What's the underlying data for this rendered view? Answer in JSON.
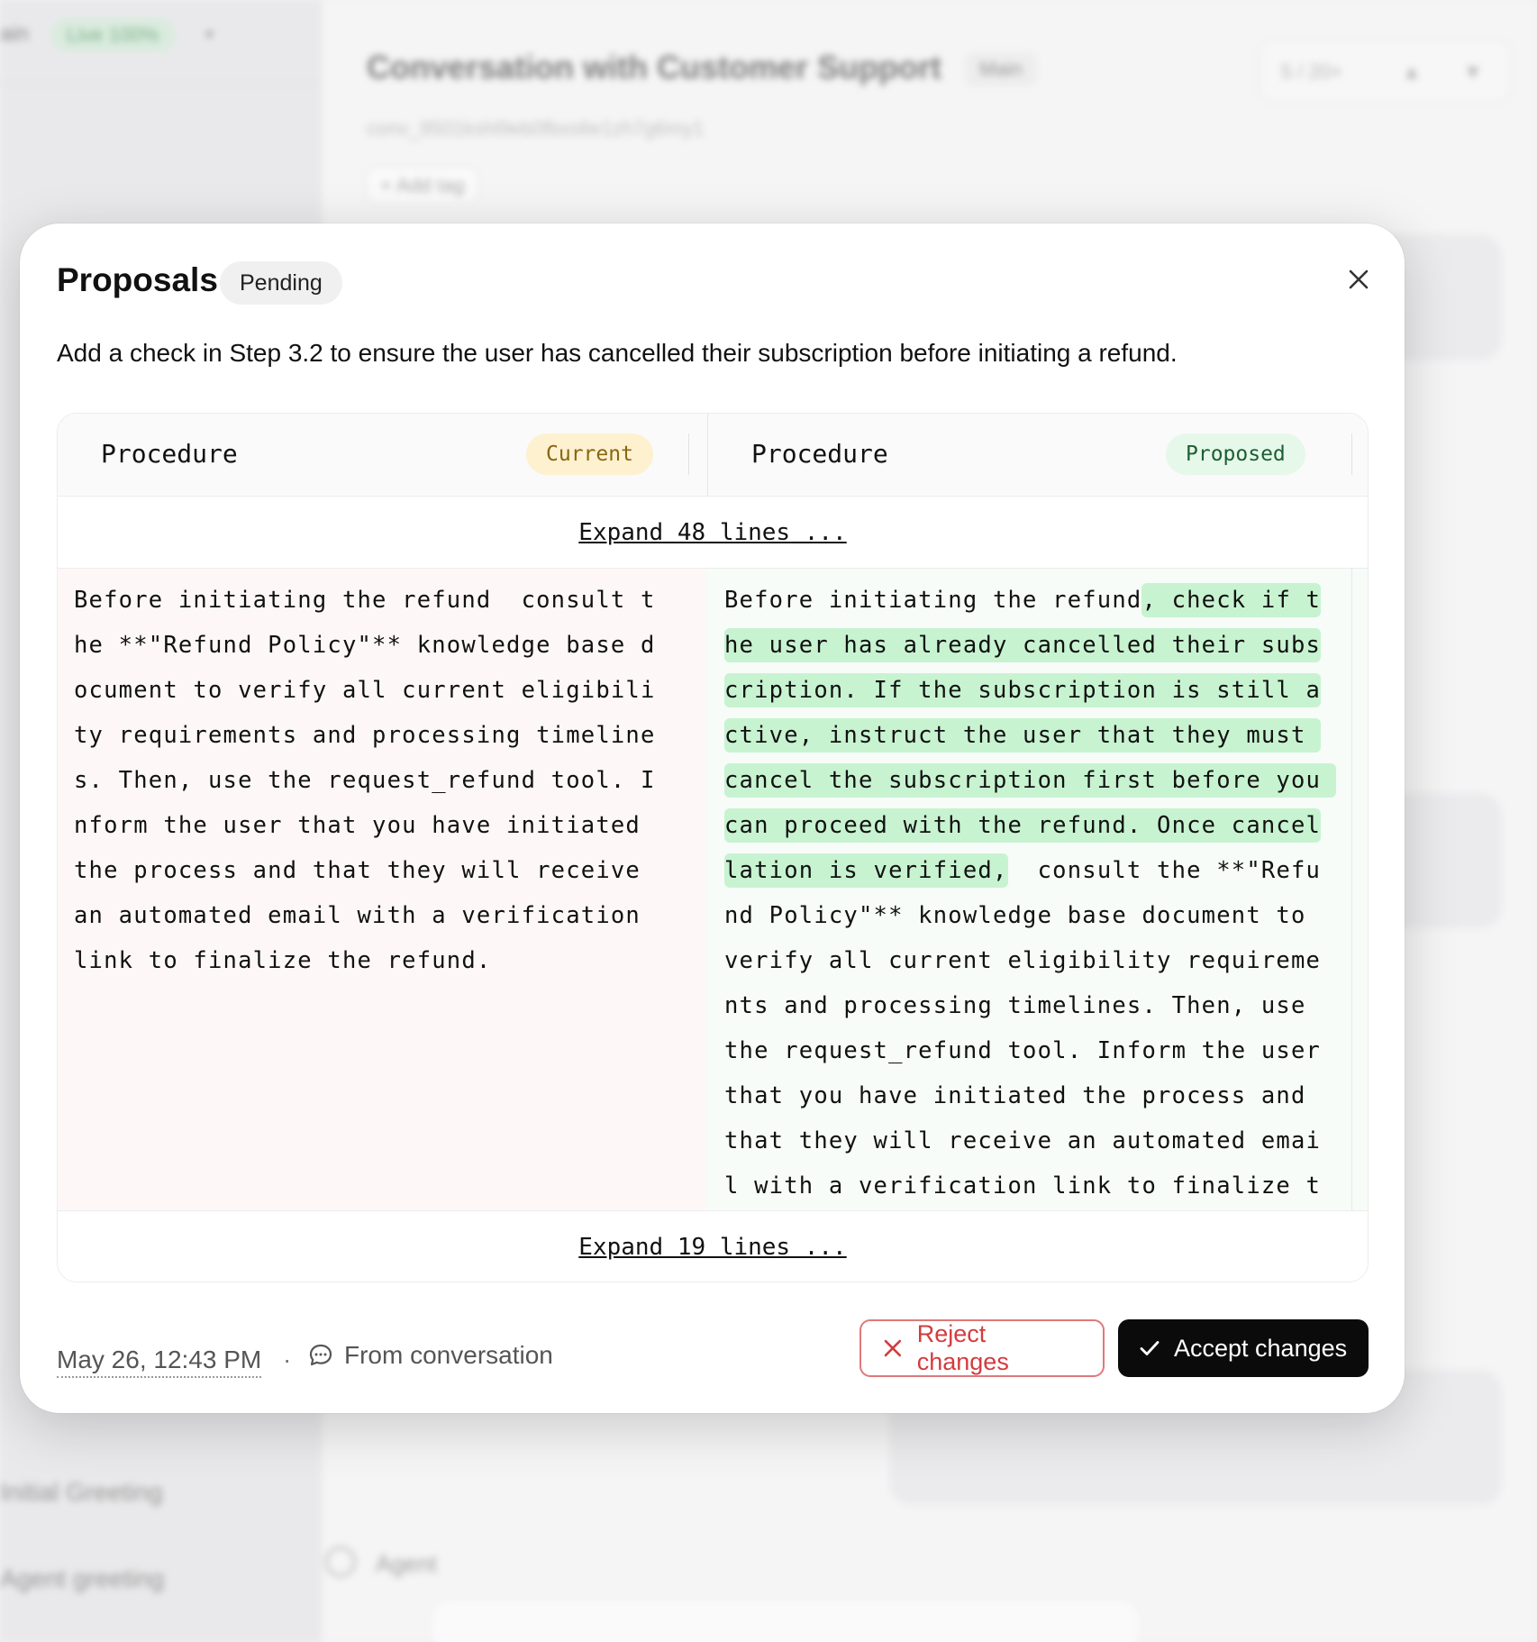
{
  "background": {
    "sidebar": {
      "env_label": "ain",
      "live_badge": "Live 100%",
      "items": [
        "Initial Greeting",
        "Agent greeting"
      ]
    },
    "main": {
      "title": "Conversation with Customer Support",
      "branch": "Main",
      "pager": "5 / 20+",
      "conversation_id": "conv_9501kshl9eb0fbxs6e1zh7g6my1",
      "add_tag": "+ Add tag",
      "agent_label": "Agent"
    }
  },
  "modal": {
    "title": "Proposals",
    "status": "Pending",
    "summary": "Add a check in Step 3.2 to ensure the user has cancelled their subscription before initiating a refund.",
    "diff": {
      "left": {
        "label": "Procedure",
        "tag": "Current"
      },
      "right": {
        "label": "Procedure",
        "tag": "Proposed"
      },
      "expand_top": "Expand 48 lines ...",
      "expand_bottom": "Expand 19 lines ...",
      "current_text": "Before initiating the refund  consult the **\"Refund Policy\"** knowledge base document to verify all current eligibility requirements and processing timelines. Then, use the request_refund tool. Inform the user that you have initiated the process and that they will receive an automated email with a verification link to finalize the refund.",
      "proposed_prefix": "Before initiating the refund",
      "proposed_inserted": ", check if the user has already cancelled their subscription. If the subscription is still active, instruct the user that they must cancel the subscription first before you can proceed with the refund. Once cancellation is verified,",
      "proposed_suffix": "  consult the **\"Refund Policy\"** knowledge base document to verify all current eligibility requirements and processing timelines. Then, use the request_refund tool. Inform the user that you have initiated the process and that they will receive an automated email with a verification link to finalize the refund."
    },
    "footer": {
      "date": "May 26, 12:43 PM",
      "separator": "·",
      "source": "From conversation"
    },
    "actions": {
      "reject": "Reject changes",
      "accept": "Accept changes"
    }
  }
}
